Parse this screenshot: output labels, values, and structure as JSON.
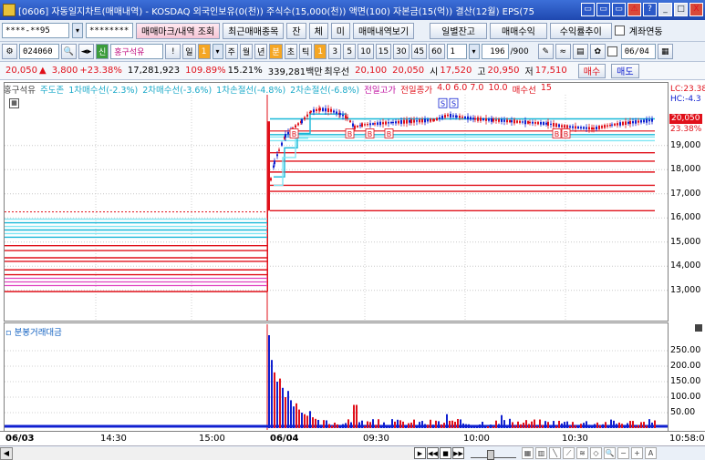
{
  "window": {
    "title": "[0606] 자동일지차트(매매내역) - KOSDAQ 외국인보유(0(천)) 주식수(15,000(천)) 액면(100) 자본금(15(억)) 결산(12월) EPS(75",
    "buttons": [
      "▭",
      "▭",
      "▭",
      "⚠",
      "?",
      "_",
      "□",
      "X"
    ]
  },
  "toolbar1": {
    "account_value": "****-**95",
    "password_value": "********",
    "btn_trade_mark": "매매마크/내역 조회",
    "btn_recent_stock": "최근매매종목",
    "btn_jan": "잔",
    "btn_che": "체",
    "btn_mi": "미",
    "btn_trade_history": "매매내역보기",
    "btn_daily_balance": "일별잔고",
    "btn_trade_profit": "매매수익",
    "btn_return_trend": "수익률추이",
    "account_link_label": "계좌연동"
  },
  "toolbar2": {
    "stock_code": "024060",
    "stock_badge": "신",
    "stock_name": "홍구석유",
    "excl": "!",
    "periods": [
      "일",
      "1",
      "주",
      "월",
      "년",
      "분",
      "초",
      "틱"
    ],
    "intervals": [
      "1",
      "3",
      "5",
      "10",
      "15",
      "30",
      "45",
      "60"
    ],
    "interval_select": "1",
    "count": "196",
    "count_total": "/900",
    "date": "06/04"
  },
  "infobar": {
    "price": "20,050",
    "arrow": "▲",
    "change": "3,800",
    "change_pct": "+23.38%",
    "volume": "17,281,923",
    "vol_ratio": "109.89%",
    "turnover": "15.21%",
    "amount": "339,281백만",
    "priority_label": "최우선",
    "ask": "20,100",
    "bid": "20,050",
    "open_label": "시",
    "open": "17,520",
    "high_label": "고",
    "high": "20,950",
    "low_label": "저",
    "low": "17,510",
    "buy": "매수",
    "sell": "매도"
  },
  "legend": {
    "name": "홍구석유",
    "main_force": "주도존",
    "tp1": "1차매수선(-2.3%)",
    "tp2": "2차매수선(-3.6%)",
    "sl1": "1차손절선(-4.8%)",
    "sl2": "2차손절선(-6.8%)",
    "prev_high": "전일고가",
    "prev_close": "전일종가",
    "pcts": "4.0  6.0  7.0",
    "ten": "10.0",
    "buy_line": "매수선",
    "fifteen": "15",
    "lc": "LC:23.38",
    "hc": "HC:-4.3"
  },
  "price_axis": {
    "labels": [
      "19,000",
      "18,000",
      "17,000",
      "16,000",
      "15,000",
      "14,000",
      "13,000"
    ],
    "current": "20,050",
    "current_pct": "23.38%"
  },
  "volume_panel": {
    "title": "분봉거래대금",
    "labels": [
      "250.00",
      "200.00",
      "150.00",
      "100.00",
      "50.00"
    ]
  },
  "time_axis": {
    "labels": [
      "06/03",
      "14:30",
      "15:00",
      "06/04",
      "09:30",
      "10:00",
      "10:30",
      "10:58:0"
    ]
  },
  "markers": {
    "sell": "S",
    "buy": "B"
  },
  "colors": {
    "up": "#e0101a",
    "down": "#1020d0",
    "cyan": "#18b8d8",
    "lightcyan": "#7fe6f4",
    "magenta": "#e040c0"
  },
  "chart_data": {
    "type": "candlestick",
    "y_range": [
      12200,
      20900
    ],
    "prev_day_closing_line": 16250,
    "high_line": 20950,
    "current_price": 20050
  }
}
